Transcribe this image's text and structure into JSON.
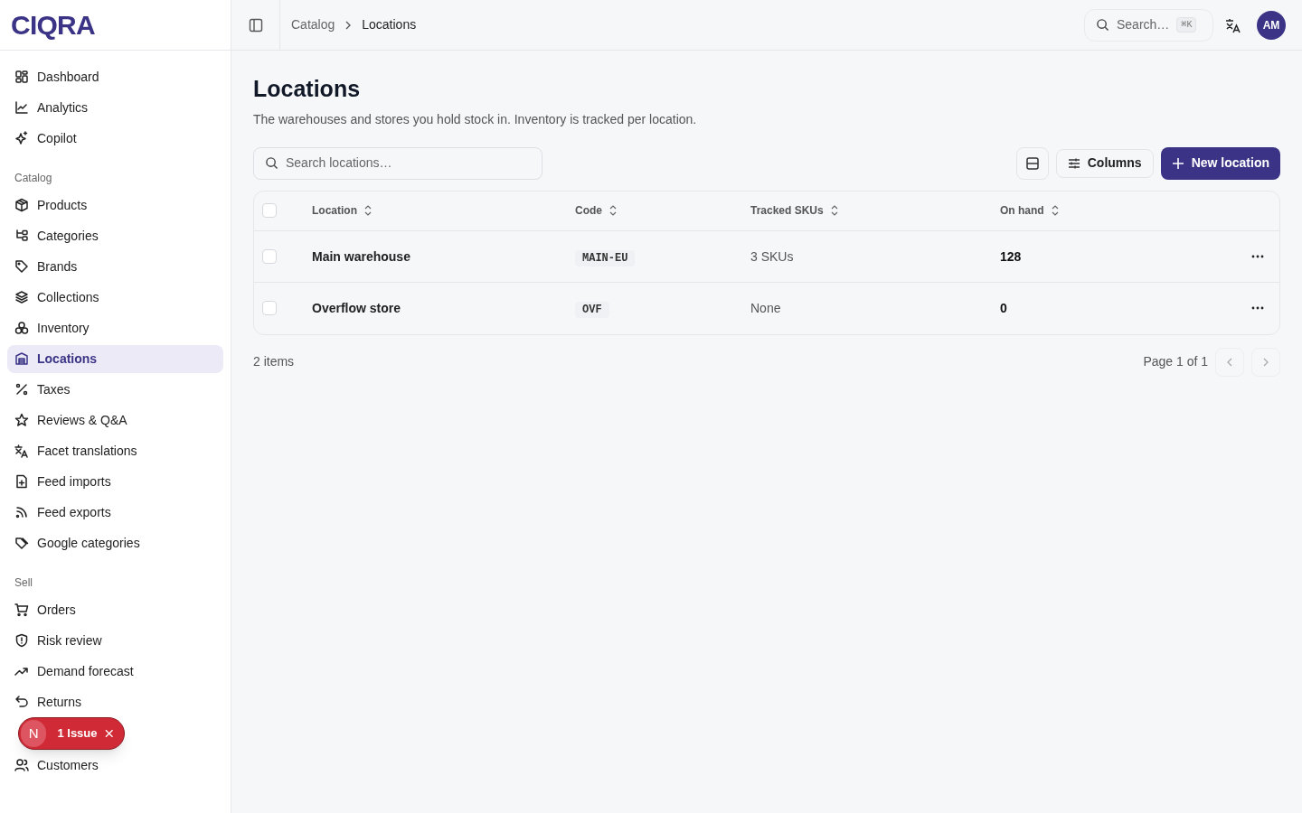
{
  "brand": "CIQRA",
  "sidebar": {
    "sections": [
      {
        "items": [
          {
            "label": "Dashboard",
            "selected": false
          },
          {
            "label": "Analytics",
            "selected": false
          },
          {
            "label": "Copilot",
            "selected": false
          }
        ]
      },
      {
        "heading": "Catalog",
        "items": [
          {
            "label": "Products",
            "selected": false
          },
          {
            "label": "Categories",
            "selected": false
          },
          {
            "label": "Brands",
            "selected": false
          },
          {
            "label": "Collections",
            "selected": false
          },
          {
            "label": "Inventory",
            "selected": false
          },
          {
            "label": "Locations",
            "selected": true
          },
          {
            "label": "Taxes",
            "selected": false
          },
          {
            "label": "Reviews & Q&A",
            "selected": false
          },
          {
            "label": "Facet translations",
            "selected": false
          },
          {
            "label": "Feed imports",
            "selected": false
          },
          {
            "label": "Feed exports",
            "selected": false
          },
          {
            "label": "Google categories",
            "selected": false
          }
        ]
      },
      {
        "heading": "Sell",
        "items": [
          {
            "label": "Orders",
            "selected": false
          },
          {
            "label": "Risk review",
            "selected": false
          },
          {
            "label": "Demand forecast",
            "selected": false
          },
          {
            "label": "Returns",
            "selected": false
          },
          {
            "label": "Customers",
            "selected": false
          }
        ]
      }
    ]
  },
  "issue_toast": {
    "avatar": "N",
    "label": "1 Issue"
  },
  "breadcrumb": [
    "Catalog",
    "Locations"
  ],
  "header": {
    "search_placeholder": "Search…",
    "shortcut": "⌘K",
    "avatar": "AM"
  },
  "page": {
    "title": "Locations",
    "subtitle": "The warehouses and stores you hold stock in. Inventory is tracked per location.",
    "search_placeholder": "Search locations…",
    "columns_button": "Columns",
    "new_button": "New location"
  },
  "table": {
    "select_all_checked": false,
    "columns": [
      "Location",
      "Code",
      "Tracked SKUs",
      "On hand"
    ],
    "rows": [
      {
        "checked": false,
        "location": "Main warehouse",
        "code": "MAIN-EU",
        "tracked": "3 SKUs",
        "on_hand": "128"
      },
      {
        "checked": false,
        "location": "Overflow store",
        "code": "OVF",
        "tracked": "None",
        "on_hand": "0"
      }
    ]
  },
  "footer": {
    "count": "2 items",
    "page": "Page 1 of 1"
  }
}
